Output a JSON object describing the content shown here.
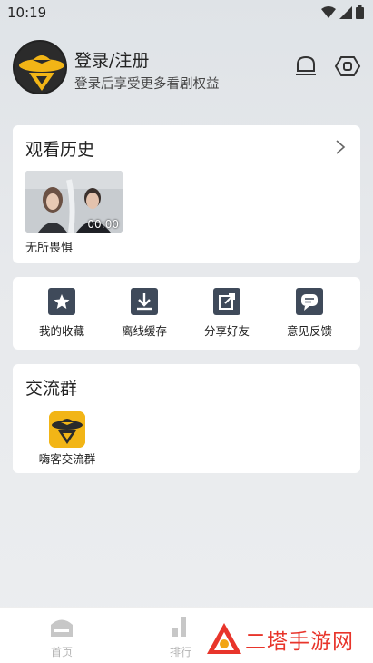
{
  "status_bar": {
    "time": "10:19"
  },
  "profile": {
    "title": "登录/注册",
    "subtitle": "登录后享受更多看剧权益"
  },
  "history": {
    "title": "观看历史",
    "items": [
      {
        "title": "无所畏惧",
        "duration": "00:00"
      }
    ]
  },
  "actions": [
    {
      "label": "我的收藏",
      "icon": "star-icon"
    },
    {
      "label": "离线缓存",
      "icon": "download-icon"
    },
    {
      "label": "分享好友",
      "icon": "share-icon"
    },
    {
      "label": "意见反馈",
      "icon": "feedback-icon"
    }
  ],
  "group": {
    "title": "交流群",
    "items": [
      {
        "label": "嗨客交流群"
      }
    ]
  },
  "tabbar": {
    "tabs": [
      {
        "label": "首页"
      },
      {
        "label": "排行"
      }
    ]
  },
  "watermark": {
    "text": "二塔手游网"
  },
  "colors": {
    "accent": "#f2b516",
    "icon_dark": "#3f4a5a",
    "watermark": "#e8352b"
  }
}
